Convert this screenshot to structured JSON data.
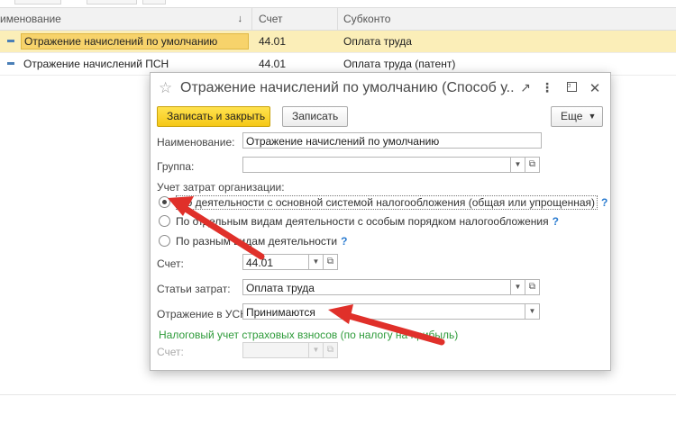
{
  "list": {
    "columns": {
      "name": "именование",
      "account": "Счет",
      "subconto": "Субконто"
    },
    "rows": [
      {
        "name": "Отражение начислений по умолчанию",
        "account": "44.01",
        "subconto": "Оплата труда",
        "selected": true
      },
      {
        "name": "Отражение начислений ПСН",
        "account": "44.01",
        "subconto": "Оплата труда (патент)",
        "selected": false
      }
    ]
  },
  "dialog": {
    "title": "Отражение начислений по умолчанию (Способ у...",
    "buttons": {
      "save_close": "Записать и закрыть",
      "save": "Записать",
      "more": "Еще"
    },
    "fields": {
      "name_label": "Наименование:",
      "name_value": "Отражение начислений по умолчанию",
      "group_label": "Группа:",
      "group_value": "",
      "cost_label": "Учет затрат организации:",
      "radio_1": "По деятельности с основной системой налогообложения (общая или упрощенная)",
      "radio_2": "По отдельным видам деятельности с особым порядком налогообложения",
      "radio_3": "По разным видам деятельности",
      "help_mark": "?",
      "account_label": "Счет:",
      "account_value": "44.01",
      "cost_items_label": "Статьи затрат:",
      "cost_items_value": "Оплата труда",
      "usn_label": "Отражение в УСН:",
      "usn_value": "Принимаются",
      "insurance_section": "Налоговый учет страховых взносов (по налогу на прибыль)",
      "insurance_account_label": "Счет:",
      "insurance_account_value": ""
    },
    "selected_radio": 1
  },
  "annotation": {
    "arrow_color": "#e0302a"
  }
}
